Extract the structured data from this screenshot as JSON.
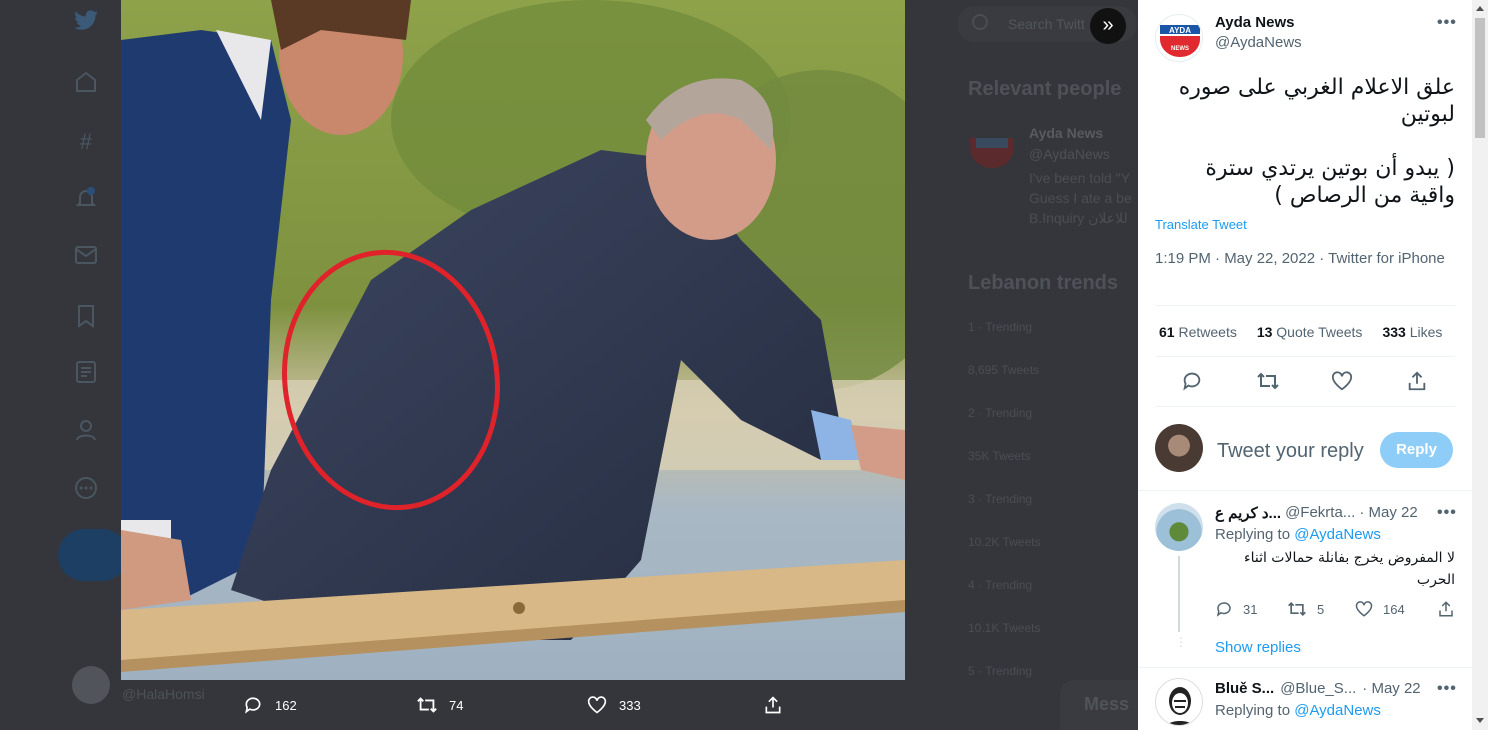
{
  "nav": {
    "handle": "@HalaHomsi"
  },
  "media": {
    "replies": "162",
    "retweets": "74",
    "likes": "333"
  },
  "background": {
    "search_placeholder": "Search Twitt",
    "relevant_title": "Relevant people",
    "relevant_name": "Ayda News",
    "relevant_handle": "@AydaNews",
    "relevant_bio_1": "I've been told \"Y",
    "relevant_bio_2": "Guess I ate a be",
    "relevant_bio_3": "B.Inquiry للاعلان",
    "trends_title": "Lebanon trends",
    "trends": [
      "1 · Trending",
      "8,695 Tweets",
      "2 · Trending",
      "35K Tweets",
      "3 · Trending",
      "10.2K Tweets",
      "4 · Trending",
      "10.1K Tweets",
      "5 · Trending"
    ],
    "messages": "Mess"
  },
  "tweet": {
    "author_name": "Ayda News",
    "author_handle": "@AydaNews",
    "logo_text": "AYDA",
    "logo_sub": "NEWS",
    "text": "علق الاعلام الغربي على صوره لبوتين\n\n( يبدو أن بوتين  يرتدي سترة واقية من الرصاص )",
    "translate": "Translate Tweet",
    "meta": "1:19 PM · May 22, 2022 · Twitter for iPhone",
    "retweets_count": "61",
    "retweets_label": "Retweets",
    "quotes_count": "13",
    "quotes_label": "Quote Tweets",
    "likes_count": "333",
    "likes_label": "Likes",
    "reply_placeholder": "Tweet your reply",
    "reply_button": "Reply"
  },
  "comments": [
    {
      "name": "د كريم ع...",
      "handle": "@Fekrta...",
      "date": "· May 22",
      "replying_prefix": "Replying to ",
      "replying_to": "@AydaNews",
      "text": "لا المفروض يخرج بفانلة حمالات اثناء الحرب",
      "replies": "31",
      "retweets": "5",
      "likes": "164",
      "show_replies": "Show replies"
    },
    {
      "name": "Bluě S...",
      "handle": "@Blue_S...",
      "date": "· May 22",
      "replying_prefix": "Replying to ",
      "replying_to": "@AydaNews"
    }
  ],
  "colors": {
    "accent": "#1d9bf0",
    "reply_button_disabled": "#8ecdf7",
    "annotation_circle": "#e0222a"
  }
}
